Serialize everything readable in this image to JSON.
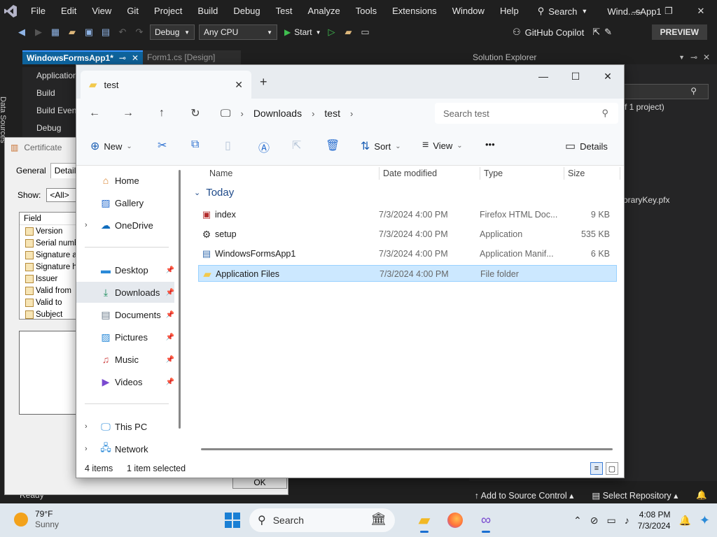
{
  "vs": {
    "menu": [
      "File",
      "Edit",
      "View",
      "Git",
      "Project",
      "Build",
      "Debug",
      "Test",
      "Analyze",
      "Tools",
      "Extensions",
      "Window",
      "Help"
    ],
    "search_label": "Search",
    "solution_name": "Wind...sApp1",
    "toolbar": {
      "config": "Debug",
      "platform": "Any CPU",
      "start_label": "Start",
      "copilot_label": "GitHub Copilot",
      "preview_label": "PREVIEW"
    },
    "left_strip_label": "Data Sources",
    "doc_tabs": [
      {
        "label": "WindowsFormsApp1*",
        "active": true
      },
      {
        "label": "Form1.cs [Design]",
        "active": false
      }
    ],
    "project_props": [
      "Application",
      "Build",
      "Build Events",
      "Debug"
    ],
    "solution_explorer_title": "Solution Explorer",
    "solution_text_1": "f 1 project)",
    "solution_text_2": "oraryKey.pfx",
    "status_ready": "Ready",
    "add_source_control": "Add to Source Control",
    "select_repository": "Select Repository"
  },
  "cert": {
    "title": "Certificate",
    "tabs": [
      "General",
      "Details"
    ],
    "show_label": "Show:",
    "show_value": "<All>",
    "field_header": "Field",
    "fields": [
      "Version",
      "Serial number",
      "Signature algorithm",
      "Signature hash algorithm",
      "Issuer",
      "Valid from",
      "Valid to",
      "Subject"
    ],
    "ok_label": "OK"
  },
  "explorer": {
    "tab_title": "test",
    "crumbs": [
      "Downloads",
      "test"
    ],
    "search_placeholder": "Search test",
    "commands": {
      "new": "New",
      "sort": "Sort",
      "view": "View",
      "more": "•••",
      "details": "Details"
    },
    "nav": {
      "home": "Home",
      "gallery": "Gallery",
      "onedrive": "OneDrive",
      "desktop": "Desktop",
      "downloads": "Downloads",
      "documents": "Documents",
      "pictures": "Pictures",
      "music": "Music",
      "videos": "Videos",
      "thispc": "This PC",
      "network": "Network"
    },
    "columns": [
      "Name",
      "Date modified",
      "Type",
      "Size"
    ],
    "group": "Today",
    "files": [
      {
        "name": "index",
        "date": "7/3/2024 4:00 PM",
        "type": "Firefox HTML Doc...",
        "size": "9 KB"
      },
      {
        "name": "setup",
        "date": "7/3/2024 4:00 PM",
        "type": "Application",
        "size": "535 KB"
      },
      {
        "name": "WindowsFormsApp1",
        "date": "7/3/2024 4:00 PM",
        "type": "Application Manif...",
        "size": "6 KB"
      },
      {
        "name": "Application Files",
        "date": "7/3/2024 4:00 PM",
        "type": "File folder",
        "size": ""
      }
    ],
    "status_count": "4 items",
    "status_selected": "1 item selected"
  },
  "taskbar": {
    "temp": "79°F",
    "condition": "Sunny",
    "search_label": "Search",
    "time": "4:08 PM",
    "date": "7/3/2024"
  }
}
